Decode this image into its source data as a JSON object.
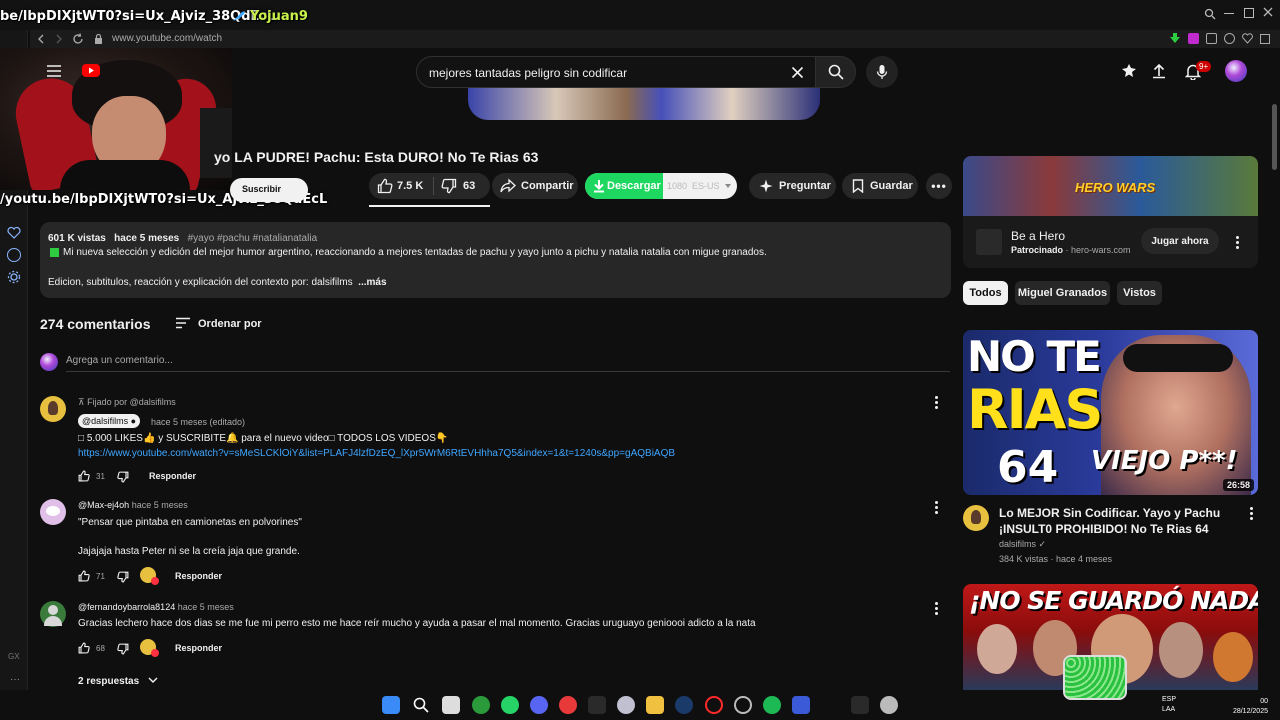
{
  "stream": {
    "overlay_link_top": "be/lbpDIXjtWT0?si=Ux_Ajviz_38QdEcL",
    "overlay_user": "Yojuan9",
    "overlay_link_bottom": "/youtu.be/lbpDIXjtWT0?si=Ux_Ajviz_38QdEcL"
  },
  "browser": {
    "url": "www.youtube.com/watch"
  },
  "header": {
    "search_value": "mejores tantadas peligro sin codificar",
    "notifications_badge": "9+"
  },
  "video": {
    "title_partial": "yo LA PUDRE! Pachu: Esta DURO! No Te Rias 63",
    "subscribe_partial": "Suscribir",
    "likes": "7.5 K",
    "dislikes": "63",
    "share_label": "Compartir",
    "download_label": "Descargar",
    "quality": "1080",
    "lang": "ES-US",
    "ask_label": "Preguntar",
    "save_label": "Guardar"
  },
  "description": {
    "views": "601 K vistas",
    "age": "hace 5 meses",
    "tags": "#yayo #pachu #natalianatalia",
    "line1": "Mi nueva selección y edición del mejor humor argentino, reaccionando a mejores tentadas de pachu y yayo junto a pichu y natalia natalia con migue granados.",
    "line2": "Edicion, subtitulos, reacción y explicación del contexto por: dalsifilms",
    "more": "...más"
  },
  "comments": {
    "count": "274 comentarios",
    "sort_label": "Ordenar por",
    "add_placeholder": "Agrega un comentario...",
    "items": [
      {
        "pinned": "Fijado por @dalsifilms",
        "author": "@dalsifilms",
        "time": "hace 5 meses (editado)",
        "text": "□ 5.000 LIKES👍 y SUSCRIBITE🔔 para el nuevo video□ TODOS LOS VIDEOS👇",
        "link": "https://www.youtube.com/watch?v=sMeSLCKlOiY&list=PLAFJ4lzfDzEQ_lXpr5WrM6RtEVHhha7Q5&index=1&t=1240s&pp=gAQBiAQB",
        "likes": "31",
        "reply": "Responder"
      },
      {
        "author": "@Max-ej4oh",
        "time": "hace 5 meses",
        "text": "\"Pensar que pintaba en camionetas en polvorines\"",
        "text2": "Jajajaja hasta Peter ni se la creía jaja que grande.",
        "likes": "71",
        "reply": "Responder"
      },
      {
        "author": "@fernandoybarrola8124",
        "time": "hace 5 meses",
        "text": "Gracias lechero hace dos dias se me fue mi perro esto me hace reír mucho y ayuda a pasar el mal momento. Gracias uruguayo genioooi adicto a la nata",
        "likes": "68",
        "reply": "Responder",
        "replies": "2 respuestas"
      }
    ]
  },
  "ad": {
    "banner_text": "HERO WARS",
    "title": "Be a Hero",
    "sponsored": "Patrocinado",
    "domain": "hero-wars.com",
    "cta": "Jugar ahora"
  },
  "chips": [
    "Todos",
    "Miguel Granados",
    "Vistos"
  ],
  "recommended": [
    {
      "thumb_line1": "NO TE",
      "thumb_line2": "RIAS",
      "thumb_line3": "64",
      "thumb_line4": "VIEJO P**!",
      "duration": "26:58",
      "title": "Lo MEJOR Sin Codificar. Yayo y Pachu ¡INSULT0 PROHIBIDO! No Te Rias 64",
      "channel": "dalsifilms",
      "meta": "384 K vistas · hace 4 meses"
    },
    {
      "thumb_text": "¡NO SE GUARDÓ NADA!"
    }
  ],
  "taskbar": {
    "lang1": "ESP",
    "lang2": "LAA",
    "date": "28/12/2025",
    "time": "00"
  },
  "colors": {
    "bg": "#0f0f0f",
    "youtube_red": "#ff0000",
    "download_green": "#1ed760",
    "link_blue": "#3ea6ff"
  }
}
